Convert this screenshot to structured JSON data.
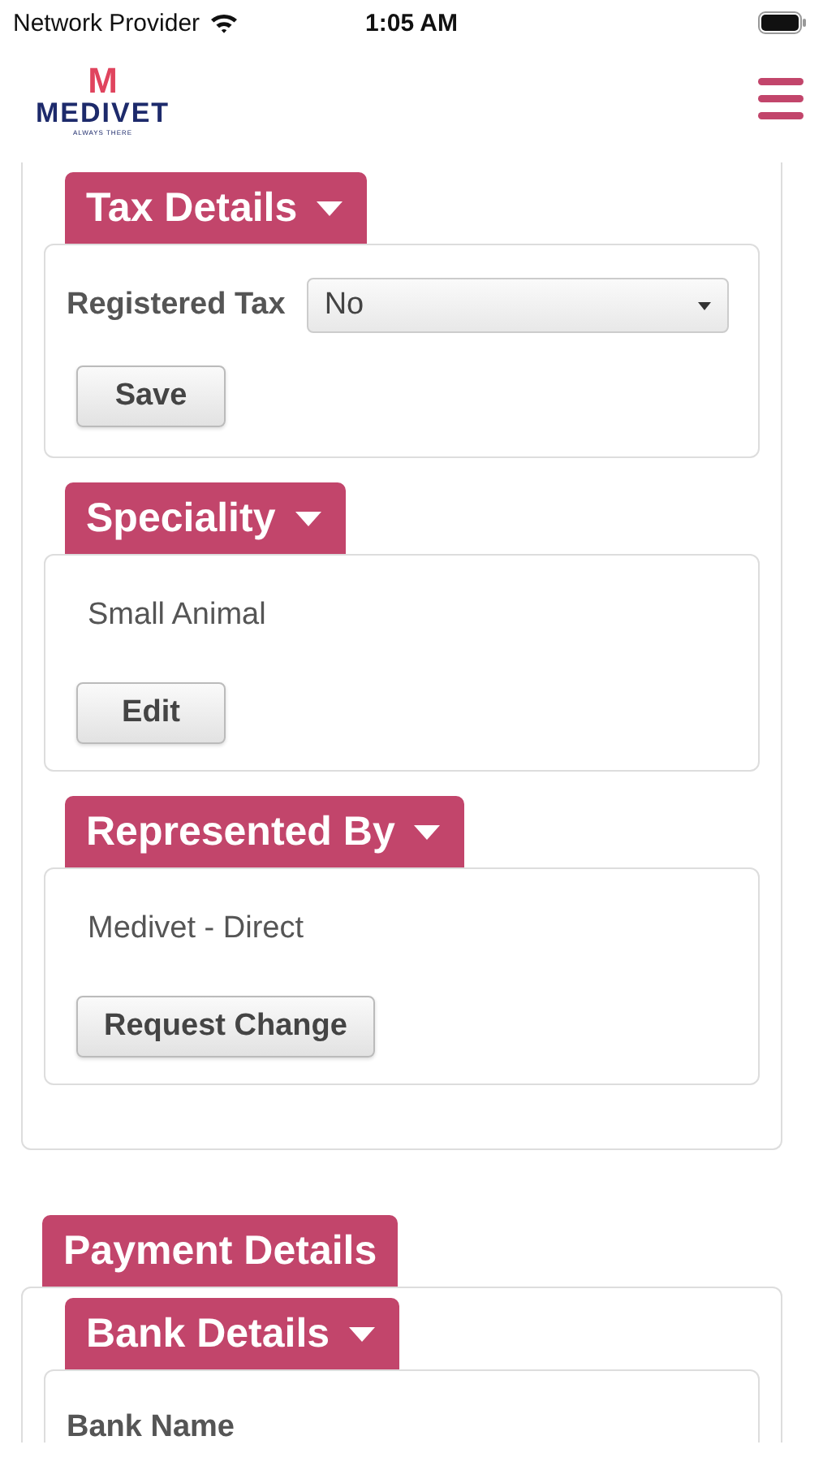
{
  "status_bar": {
    "carrier": "Network Provider",
    "time": "1:05 AM"
  },
  "header": {
    "logo_mark": "M",
    "logo_name": "MEDIVET",
    "logo_tagline": "ALWAYS THERE"
  },
  "groups": [
    {
      "sections": [
        {
          "kind": "field",
          "title": "Tax Details",
          "collapsible": true,
          "label": "Registered Tax",
          "value": "No",
          "button": "Save"
        },
        {
          "kind": "value",
          "title": "Speciality",
          "collapsible": true,
          "value": "Small Animal",
          "button": "Edit"
        },
        {
          "kind": "value",
          "title": "Represented By",
          "collapsible": true,
          "value": "Medivet - Direct",
          "button": "Request Change"
        }
      ]
    },
    {
      "title": "Payment Details",
      "sections": [
        {
          "kind": "label",
          "title": "Bank Details",
          "collapsible": true,
          "label": "Bank Name"
        }
      ]
    }
  ]
}
